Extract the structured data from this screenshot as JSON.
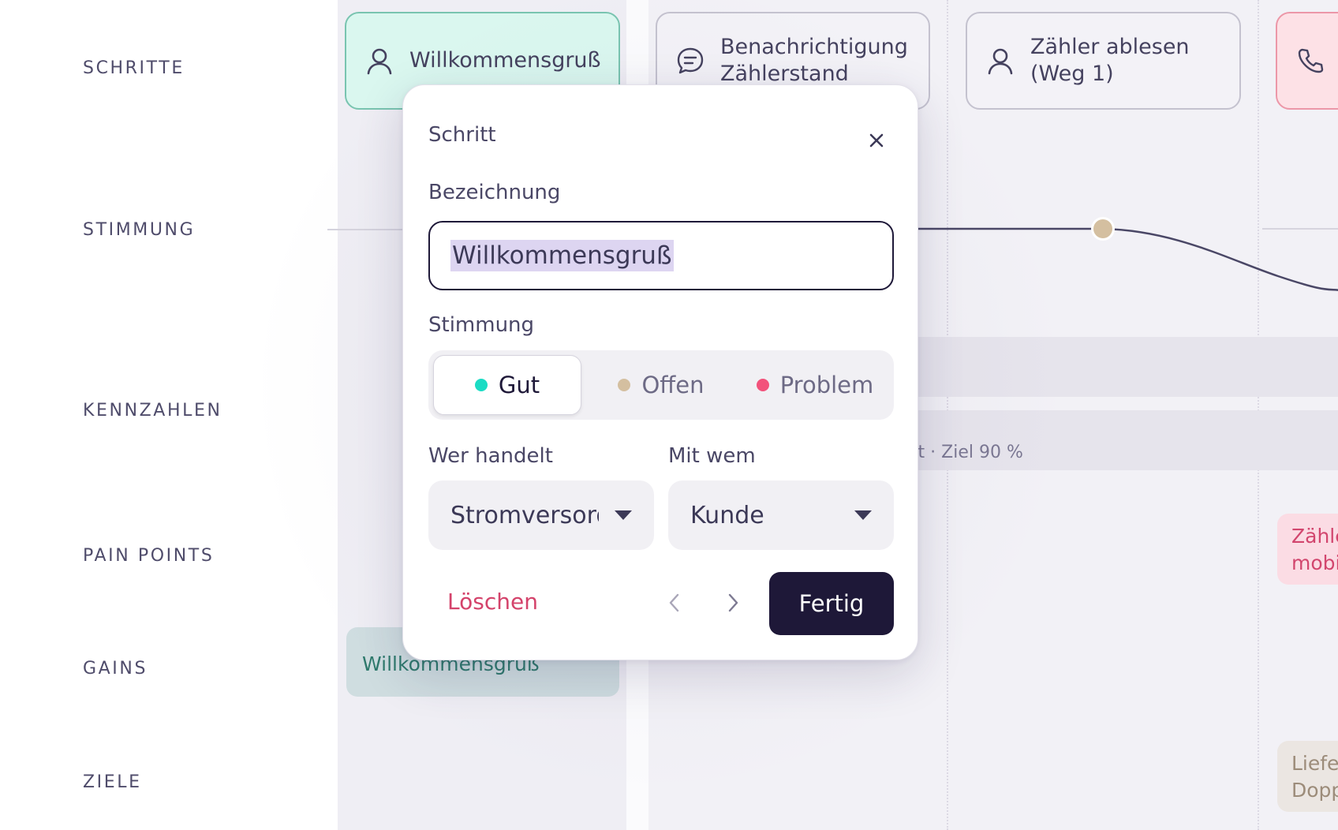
{
  "rows": {
    "schritte": "SCHRITTE",
    "stimmung": "STIMMUNG",
    "kennzahlen": "KENNZAHLEN",
    "pain_points": "PAIN POINTS",
    "gains": "GAINS",
    "ziele": "ZIELE"
  },
  "steps": [
    {
      "label": "Willkommensgruß",
      "icon": "user-icon",
      "active": true
    },
    {
      "label": "Benachrichtigung Zählerstand",
      "icon": "chat-bubble-icon"
    },
    {
      "label": "Zähler ablesen (Weg 1)",
      "icon": "user-icon"
    },
    {
      "label": "",
      "icon": "phone-icon"
    }
  ],
  "kennzahlen": {
    "partial_text": "et · Ziel 90 %"
  },
  "pain_points": {
    "partial_text": "Zähle mobi"
  },
  "gains": {
    "text": "Willkommensgruß"
  },
  "ziele": {
    "partial_text": "Liefer Dopp"
  },
  "colors": {
    "good": "#1bdcc4",
    "open": "#d4bfa0",
    "problem": "#f2527b",
    "primary": "#1e1838",
    "danger": "#d4436b"
  },
  "dialog": {
    "title": "Schritt",
    "name_label": "Bezeichnung",
    "name_value": "Willkommensgruß",
    "mood_label": "Stimmung",
    "mood_options": [
      "Gut",
      "Offen",
      "Problem"
    ],
    "mood_selected": "Gut",
    "actor_label": "Wer handelt",
    "actor_value": "Stromversorger",
    "with_label": "Mit wem",
    "with_value": "Kunde",
    "delete_label": "Löschen",
    "done_label": "Fertig"
  }
}
